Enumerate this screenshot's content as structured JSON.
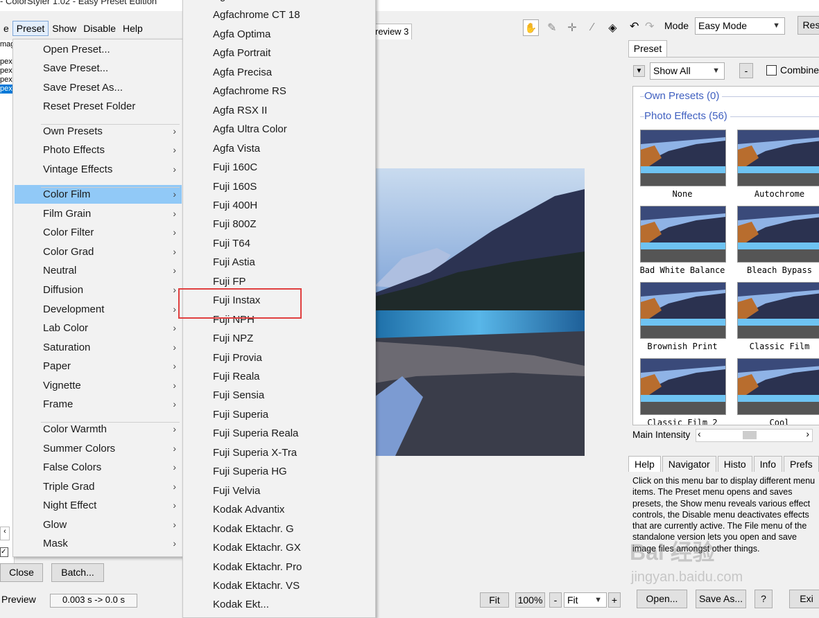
{
  "window": {
    "title": "- ColorStyler 1.02 - Easy Preset Edition"
  },
  "menubar": [
    "e",
    "Preset",
    "Show",
    "Disable",
    "Help"
  ],
  "left_strip": {
    "items": [
      "mag",
      "pex",
      "pex",
      "pex",
      "pex"
    ],
    "selected": 4
  },
  "preset_menu": {
    "items": [
      {
        "label": "Open Preset...",
        "sub": false
      },
      {
        "label": "Save Preset...",
        "sub": false
      },
      {
        "label": "Save Preset As...",
        "sub": false
      },
      {
        "label": "Reset Preset Folder",
        "sub": false
      },
      {
        "label": "Own Presets",
        "sub": true
      },
      {
        "label": "Photo Effects",
        "sub": true
      },
      {
        "label": "Vintage Effects",
        "sub": true
      },
      {
        "label": "Color Film",
        "sub": true
      },
      {
        "label": "Film Grain",
        "sub": true
      },
      {
        "label": "Color Filter",
        "sub": true
      },
      {
        "label": "Color Grad",
        "sub": true
      },
      {
        "label": "Neutral",
        "sub": true
      },
      {
        "label": "Diffusion",
        "sub": true
      },
      {
        "label": "Development",
        "sub": true
      },
      {
        "label": "Lab Color",
        "sub": true
      },
      {
        "label": "Saturation",
        "sub": true
      },
      {
        "label": "Paper",
        "sub": true
      },
      {
        "label": "Vignette",
        "sub": true
      },
      {
        "label": "Frame",
        "sub": true
      },
      {
        "label": "Color Warmth",
        "sub": true
      },
      {
        "label": "Summer Colors",
        "sub": true
      },
      {
        "label": "False Colors",
        "sub": true
      },
      {
        "label": "Triple Grad",
        "sub": true
      },
      {
        "label": "Night Effect",
        "sub": true
      },
      {
        "label": "Glow",
        "sub": true
      },
      {
        "label": "Mask",
        "sub": true
      }
    ],
    "highlighted": "Color Film",
    "arrow": "›"
  },
  "color_film_menu": {
    "items": [
      "Agfachrome",
      "Agfachrome CT 18",
      "Agfa Optima",
      "Agfa Portrait",
      "Agfa Precisa",
      "Agfachrome RS",
      "Agfa RSX II",
      "Agfa Ultra Color",
      "Agfa Vista",
      "Fuji 160C",
      "Fuji 160S",
      "Fuji 400H",
      "Fuji 800Z",
      "Fuji T64",
      "Fuji Astia",
      "Fuji FP",
      "Fuji Instax",
      "Fuji NPH",
      "Fuji NPZ",
      "Fuji Provia",
      "Fuji Reala",
      "Fuji Sensia",
      "Fuji Superia",
      "Fuji Superia Reala",
      "Fuji Superia X-Tra",
      "Fuji Superia HG",
      "Fuji Velvia",
      "Kodak Advantix",
      "Kodak Ektachr. G",
      "Kodak Ektachr. GX",
      "Kodak Ektachr. Pro",
      "Kodak Ektachr. VS",
      "Kodak Ekt..."
    ],
    "annotated": "Fuji Instax"
  },
  "preview": {
    "tab_label": "review 3"
  },
  "top_right": {
    "mode_label": "Mode",
    "mode_value": "Easy Mode",
    "reset_label": "Res"
  },
  "preset_panel": {
    "tab": "Preset",
    "filter": "Show All",
    "minus": "-",
    "combine": "Combine",
    "groups": [
      {
        "label": "Own Presets (0)"
      },
      {
        "label": "Photo Effects (56)"
      }
    ],
    "thumbs": [
      "None",
      "Autochrome",
      "Bad White Balance",
      "Bleach Bypass",
      "Brownish Print",
      "Classic Film",
      "Classic Film 2",
      "Cool"
    ]
  },
  "intensity": {
    "label": "Main Intensity",
    "value": 0.38
  },
  "bottom_tabs": [
    "Help",
    "Navigator",
    "Histo",
    "Info",
    "Prefs"
  ],
  "help_text": "Click on this menu bar to display different menu items. The Preset menu opens and saves presets, the Show menu reveals various effect controls, the Disable menu deactivates effects that are currently active. The File menu of the standalone version lets you open and save image files amongst other things.",
  "watermark": {
    "main": "Bai 经验",
    "sub": "jingyan.baidu.com"
  },
  "bottom": {
    "close": "Close",
    "batch": "Batch...",
    "preview": "Preview",
    "timing": "0.003 s -> 0.0 s",
    "fit1": "Fit",
    "zoom": "100%",
    "minus": "-",
    "fit2": "Fit",
    "plus": "+",
    "open": "Open...",
    "saveas": "Save As...",
    "help": "?",
    "exit": "Exi"
  },
  "colors": {
    "highlight": "#91c9f7",
    "annotation": "#e04040",
    "group": "#4060c0"
  }
}
